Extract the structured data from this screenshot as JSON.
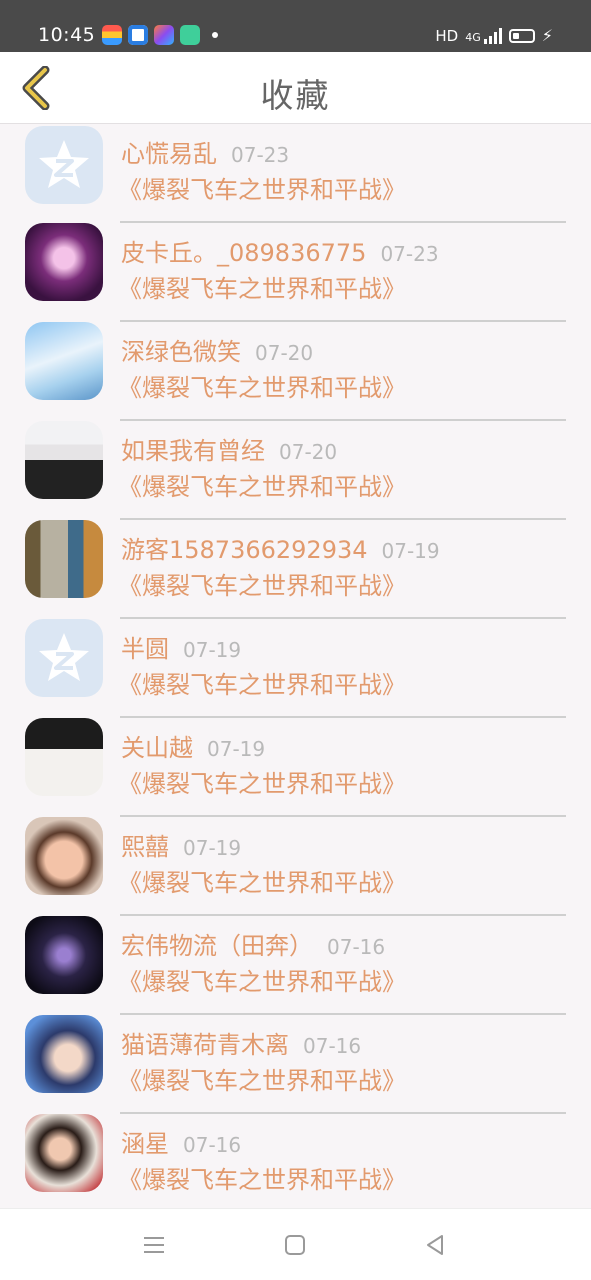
{
  "status_bar": {
    "time": "10:45",
    "network": "HD",
    "signal_text": "4G",
    "app_icons": [
      "wallet-app-icon",
      "browser-app-icon",
      "gallery-app-icon",
      "chat-app-icon"
    ]
  },
  "header": {
    "title": "收藏",
    "back_icon": "chevron-left-icon",
    "accent_color": "#e0b83c"
  },
  "items": [
    {
      "name": "心慌易乱",
      "date": "07-23",
      "book": "《爆裂飞车之世界和平战》",
      "avatar": "default-star-avatar"
    },
    {
      "name": "皮卡丘。_089836775",
      "date": "07-23",
      "book": "《爆裂飞车之世界和平战》",
      "avatar": "anime-purple-avatar"
    },
    {
      "name": "深绿色微笑",
      "date": "07-20",
      "book": "《爆裂飞车之世界和平战》",
      "avatar": "sky-anime-avatar"
    },
    {
      "name": "如果我有曾经",
      "date": "07-20",
      "book": "《爆裂飞车之世界和平战》",
      "avatar": "girl-black-dress-avatar"
    },
    {
      "name": "游客1587366292934",
      "date": "07-19",
      "book": "《爆裂飞车之世界和平战》",
      "avatar": "street-photo-avatar"
    },
    {
      "name": "半圆",
      "date": "07-19",
      "book": "《爆裂飞车之世界和平战》",
      "avatar": "default-star-avatar"
    },
    {
      "name": "关山越",
      "date": "07-19",
      "book": "《爆裂飞车之世界和平战》",
      "avatar": "sketch-glasses-avatar"
    },
    {
      "name": "熙囍",
      "date": "07-19",
      "book": "《爆裂飞车之世界和平战》",
      "avatar": "child-photo-avatar"
    },
    {
      "name": "宏伟物流（田奔）",
      "date": "07-16",
      "book": "《爆裂飞车之世界和平战》",
      "avatar": "dark-robot-avatar"
    },
    {
      "name": "猫语薄荷青木离",
      "date": "07-16",
      "book": "《爆裂飞车之世界和平战》",
      "avatar": "anime-girl-blue-avatar"
    },
    {
      "name": "涵星",
      "date": "07-16",
      "book": "《爆裂飞车之世界和平战》",
      "avatar": "woman-photo-avatar"
    }
  ],
  "colors": {
    "name_text": "#e29a6d",
    "date_text": "#b9b9b9",
    "title_text": "#666666",
    "page_bg": "#f8f5f7"
  },
  "bottom_nav": {
    "icons": [
      "menu-icon",
      "home-square-icon",
      "back-triangle-icon"
    ]
  }
}
